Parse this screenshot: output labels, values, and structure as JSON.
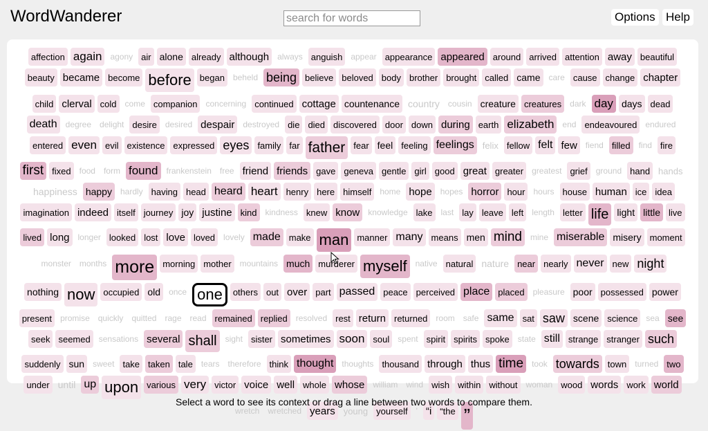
{
  "app": {
    "title": "WordWanderer"
  },
  "search": {
    "placeholder": "search for words",
    "value": ""
  },
  "nav": {
    "options_label": "Options",
    "help_label": "Help"
  },
  "status": {
    "text": "Select a word to see its context or drag a line between two words to compare them."
  },
  "selected_word": "one",
  "colors": {
    "page_bg": "#efefef",
    "panel_bg": "#ffffff",
    "faint_text": "#c9c9c9",
    "shade_1": "#f4e2ea",
    "shade_2": "#ecccda",
    "shade_3": "#e3b6ca",
    "shade_4": "#d99fb9"
  },
  "words": [
    {
      "t": "affection",
      "s": 13,
      "l": 1
    },
    {
      "t": "again",
      "s": 17,
      "l": 1
    },
    {
      "t": "agony",
      "s": 12,
      "l": 0
    },
    {
      "t": "air",
      "s": 13,
      "l": 1
    },
    {
      "t": "alone",
      "s": 14,
      "l": 1
    },
    {
      "t": "already",
      "s": 13,
      "l": 1
    },
    {
      "t": "although",
      "s": 15,
      "l": 1
    },
    {
      "t": "always",
      "s": 12,
      "l": 0
    },
    {
      "t": "anguish",
      "s": 13,
      "l": 1
    },
    {
      "t": "appear",
      "s": 12,
      "l": 0
    },
    {
      "t": "appearance",
      "s": 13,
      "l": 1
    },
    {
      "t": "appeared",
      "s": 15,
      "l": 3
    },
    {
      "t": "around",
      "s": 13,
      "l": 1
    },
    {
      "t": "arrived",
      "s": 13,
      "l": 1
    },
    {
      "t": "attention",
      "s": 13,
      "l": 1
    },
    {
      "t": "away",
      "s": 15,
      "l": 1
    },
    {
      "t": "beautiful",
      "s": 13,
      "l": 1
    },
    {
      "t": "beauty",
      "s": 13,
      "l": 1
    },
    {
      "t": "became",
      "s": 15,
      "l": 1
    },
    {
      "t": "become",
      "s": 13,
      "l": 1
    },
    {
      "t": "before",
      "s": 22,
      "l": 1
    },
    {
      "t": "began",
      "s": 13,
      "l": 1
    },
    {
      "t": "beheld",
      "s": 12,
      "l": 0
    },
    {
      "t": "being",
      "s": 18,
      "l": 3
    },
    {
      "t": "believe",
      "s": 13,
      "l": 1
    },
    {
      "t": "beloved",
      "s": 13,
      "l": 1
    },
    {
      "t": "body",
      "s": 13,
      "l": 1
    },
    {
      "t": "brother",
      "s": 13,
      "l": 1
    },
    {
      "t": "brought",
      "s": 13,
      "l": 1
    },
    {
      "t": "called",
      "s": 13,
      "l": 1
    },
    {
      "t": "came",
      "s": 14,
      "l": 1
    },
    {
      "t": "care",
      "s": 12,
      "l": 0
    },
    {
      "t": "cause",
      "s": 13,
      "l": 1
    },
    {
      "t": "change",
      "s": 13,
      "l": 1
    },
    {
      "t": "chapter",
      "s": 15,
      "l": 1
    },
    {
      "t": "child",
      "s": 13,
      "l": 1
    },
    {
      "t": "clerval",
      "s": 15,
      "l": 1
    },
    {
      "t": "cold",
      "s": 13,
      "l": 1
    },
    {
      "t": "come",
      "s": 12,
      "l": 0
    },
    {
      "t": "companion",
      "s": 13,
      "l": 1
    },
    {
      "t": "concerning",
      "s": 12,
      "l": 0
    },
    {
      "t": "continued",
      "s": 13,
      "l": 1
    },
    {
      "t": "cottage",
      "s": 15,
      "l": 1
    },
    {
      "t": "countenance",
      "s": 14,
      "l": 1
    },
    {
      "t": "country",
      "s": 14,
      "l": 0
    },
    {
      "t": "cousin",
      "s": 12,
      "l": 0
    },
    {
      "t": "creature",
      "s": 14,
      "l": 1
    },
    {
      "t": "creatures",
      "s": 13,
      "l": 2
    },
    {
      "t": "dark",
      "s": 12,
      "l": 0
    },
    {
      "t": "day",
      "s": 17,
      "l": 4
    },
    {
      "t": "days",
      "s": 14,
      "l": 1
    },
    {
      "t": "dead",
      "s": 13,
      "l": 1
    },
    {
      "t": "death",
      "s": 16,
      "l": 1
    },
    {
      "t": "degree",
      "s": 12,
      "l": 0
    },
    {
      "t": "delight",
      "s": 12,
      "l": 0
    },
    {
      "t": "desire",
      "s": 13,
      "l": 1
    },
    {
      "t": "desired",
      "s": 12,
      "l": 0
    },
    {
      "t": "despair",
      "s": 15,
      "l": 1
    },
    {
      "t": "destroyed",
      "s": 12,
      "l": 0
    },
    {
      "t": "die",
      "s": 13,
      "l": 1
    },
    {
      "t": "died",
      "s": 13,
      "l": 1
    },
    {
      "t": "discovered",
      "s": 13,
      "l": 1
    },
    {
      "t": "door",
      "s": 13,
      "l": 1
    },
    {
      "t": "down",
      "s": 13,
      "l": 1
    },
    {
      "t": "during",
      "s": 15,
      "l": 2
    },
    {
      "t": "earth",
      "s": 13,
      "l": 1
    },
    {
      "t": "elizabeth",
      "s": 17,
      "l": 2
    },
    {
      "t": "end",
      "s": 12,
      "l": 0
    },
    {
      "t": "endeavoured",
      "s": 13,
      "l": 1
    },
    {
      "t": "endured",
      "s": 12,
      "l": 0
    },
    {
      "t": "entered",
      "s": 13,
      "l": 1
    },
    {
      "t": "even",
      "s": 17,
      "l": 1
    },
    {
      "t": "evil",
      "s": 13,
      "l": 1
    },
    {
      "t": "existence",
      "s": 13,
      "l": 1
    },
    {
      "t": "expressed",
      "s": 13,
      "l": 1
    },
    {
      "t": "eyes",
      "s": 18,
      "l": 1
    },
    {
      "t": "family",
      "s": 13,
      "l": 1
    },
    {
      "t": "far",
      "s": 13,
      "l": 1
    },
    {
      "t": "father",
      "s": 21,
      "l": 2
    },
    {
      "t": "fear",
      "s": 13,
      "l": 1
    },
    {
      "t": "feel",
      "s": 14,
      "l": 1
    },
    {
      "t": "feeling",
      "s": 13,
      "l": 1
    },
    {
      "t": "feelings",
      "s": 16,
      "l": 2
    },
    {
      "t": "felix",
      "s": 13,
      "l": 0
    },
    {
      "t": "fellow",
      "s": 13,
      "l": 1
    },
    {
      "t": "felt",
      "s": 16,
      "l": 1
    },
    {
      "t": "few",
      "s": 15,
      "l": 1
    },
    {
      "t": "fiend",
      "s": 12,
      "l": 0
    },
    {
      "t": "filled",
      "s": 13,
      "l": 2
    },
    {
      "t": "find",
      "s": 12,
      "l": 0
    },
    {
      "t": "fire",
      "s": 13,
      "l": 1
    },
    {
      "t": "first",
      "s": 19,
      "l": 3
    },
    {
      "t": "fixed",
      "s": 13,
      "l": 1
    },
    {
      "t": "food",
      "s": 12,
      "l": 0
    },
    {
      "t": "form",
      "s": 12,
      "l": 0
    },
    {
      "t": "found",
      "s": 17,
      "l": 3
    },
    {
      "t": "frankenstein",
      "s": 12,
      "l": 0
    },
    {
      "t": "free",
      "s": 12,
      "l": 0
    },
    {
      "t": "friend",
      "s": 15,
      "l": 1
    },
    {
      "t": "friends",
      "s": 15,
      "l": 2
    },
    {
      "t": "gave",
      "s": 13,
      "l": 1
    },
    {
      "t": "geneva",
      "s": 13,
      "l": 1
    },
    {
      "t": "gentle",
      "s": 13,
      "l": 1
    },
    {
      "t": "girl",
      "s": 13,
      "l": 1
    },
    {
      "t": "good",
      "s": 13,
      "l": 1
    },
    {
      "t": "great",
      "s": 15,
      "l": 1
    },
    {
      "t": "greater",
      "s": 13,
      "l": 1
    },
    {
      "t": "greatest",
      "s": 12,
      "l": 0
    },
    {
      "t": "grief",
      "s": 13,
      "l": 1
    },
    {
      "t": "ground",
      "s": 12,
      "l": 0
    },
    {
      "t": "hand",
      "s": 13,
      "l": 1
    },
    {
      "t": "hands",
      "s": 13,
      "l": 0
    },
    {
      "t": "happiness",
      "s": 14,
      "l": 0
    },
    {
      "t": "happy",
      "s": 14,
      "l": 2
    },
    {
      "t": "hardly",
      "s": 12,
      "l": 0
    },
    {
      "t": "having",
      "s": 13,
      "l": 1
    },
    {
      "t": "head",
      "s": 13,
      "l": 1
    },
    {
      "t": "heard",
      "s": 16,
      "l": 2
    },
    {
      "t": "heart",
      "s": 17,
      "l": 1
    },
    {
      "t": "henry",
      "s": 13,
      "l": 1
    },
    {
      "t": "here",
      "s": 13,
      "l": 1
    },
    {
      "t": "himself",
      "s": 13,
      "l": 1
    },
    {
      "t": "home",
      "s": 12,
      "l": 0
    },
    {
      "t": "hope",
      "s": 15,
      "l": 1
    },
    {
      "t": "hopes",
      "s": 12,
      "l": 0
    },
    {
      "t": "horror",
      "s": 15,
      "l": 2
    },
    {
      "t": "hour",
      "s": 13,
      "l": 1
    },
    {
      "t": "hours",
      "s": 12,
      "l": 0
    },
    {
      "t": "house",
      "s": 13,
      "l": 1
    },
    {
      "t": "human",
      "s": 15,
      "l": 1
    },
    {
      "t": "ice",
      "s": 13,
      "l": 1
    },
    {
      "t": "idea",
      "s": 13,
      "l": 1
    },
    {
      "t": "imagination",
      "s": 13,
      "l": 1
    },
    {
      "t": "indeed",
      "s": 15,
      "l": 1
    },
    {
      "t": "itself",
      "s": 13,
      "l": 1
    },
    {
      "t": "journey",
      "s": 13,
      "l": 1
    },
    {
      "t": "joy",
      "s": 14,
      "l": 1
    },
    {
      "t": "justine",
      "s": 15,
      "l": 1
    },
    {
      "t": "kind",
      "s": 13,
      "l": 2
    },
    {
      "t": "kindness",
      "s": 12,
      "l": 0
    },
    {
      "t": "knew",
      "s": 13,
      "l": 1
    },
    {
      "t": "know",
      "s": 15,
      "l": 2
    },
    {
      "t": "knowledge",
      "s": 12,
      "l": 0
    },
    {
      "t": "lake",
      "s": 13,
      "l": 1
    },
    {
      "t": "last",
      "s": 12,
      "l": 0
    },
    {
      "t": "lay",
      "s": 13,
      "l": 1
    },
    {
      "t": "leave",
      "s": 13,
      "l": 1
    },
    {
      "t": "left",
      "s": 13,
      "l": 1
    },
    {
      "t": "length",
      "s": 12,
      "l": 0
    },
    {
      "t": "letter",
      "s": 13,
      "l": 1
    },
    {
      "t": "life",
      "s": 20,
      "l": 3
    },
    {
      "t": "light",
      "s": 14,
      "l": 1
    },
    {
      "t": "little",
      "s": 14,
      "l": 3
    },
    {
      "t": "live",
      "s": 13,
      "l": 1
    },
    {
      "t": "lived",
      "s": 13,
      "l": 2
    },
    {
      "t": "long",
      "s": 15,
      "l": 1
    },
    {
      "t": "longer",
      "s": 12,
      "l": 0
    },
    {
      "t": "looked",
      "s": 13,
      "l": 1
    },
    {
      "t": "lost",
      "s": 13,
      "l": 1
    },
    {
      "t": "love",
      "s": 15,
      "l": 1
    },
    {
      "t": "loved",
      "s": 13,
      "l": 1
    },
    {
      "t": "lovely",
      "s": 12,
      "l": 0
    },
    {
      "t": "made",
      "s": 16,
      "l": 2
    },
    {
      "t": "make",
      "s": 13,
      "l": 1
    },
    {
      "t": "man",
      "s": 22,
      "l": 4
    },
    {
      "t": "manner",
      "s": 13,
      "l": 1
    },
    {
      "t": "many",
      "s": 16,
      "l": 1
    },
    {
      "t": "means",
      "s": 13,
      "l": 1
    },
    {
      "t": "men",
      "s": 14,
      "l": 1
    },
    {
      "t": "mind",
      "s": 19,
      "l": 2
    },
    {
      "t": "mine",
      "s": 12,
      "l": 0
    },
    {
      "t": "miserable",
      "s": 16,
      "l": 2
    },
    {
      "t": "misery",
      "s": 14,
      "l": 1
    },
    {
      "t": "moment",
      "s": 13,
      "l": 1
    },
    {
      "t": "monster",
      "s": 12,
      "l": 0
    },
    {
      "t": "months",
      "s": 12,
      "l": 0
    },
    {
      "t": "more",
      "s": 25,
      "l": 3
    },
    {
      "t": "morning",
      "s": 13,
      "l": 1
    },
    {
      "t": "mother",
      "s": 13,
      "l": 1
    },
    {
      "t": "mountains",
      "s": 12,
      "l": 0
    },
    {
      "t": "much",
      "s": 14,
      "l": 3
    },
    {
      "t": "murderer",
      "s": 13,
      "l": 1
    },
    {
      "t": "myself",
      "s": 22,
      "l": 3
    },
    {
      "t": "native",
      "s": 12,
      "l": 0
    },
    {
      "t": "natural",
      "s": 13,
      "l": 1
    },
    {
      "t": "nature",
      "s": 14,
      "l": 0
    },
    {
      "t": "near",
      "s": 13,
      "l": 2
    },
    {
      "t": "nearly",
      "s": 13,
      "l": 1
    },
    {
      "t": "never",
      "s": 16,
      "l": 1
    },
    {
      "t": "new",
      "s": 13,
      "l": 1
    },
    {
      "t": "night",
      "s": 18,
      "l": 1
    },
    {
      "t": "nothing",
      "s": 14,
      "l": 1
    },
    {
      "t": "now",
      "s": 22,
      "l": 1
    },
    {
      "t": "occupied",
      "s": 13,
      "l": 1
    },
    {
      "t": "old",
      "s": 14,
      "l": 1
    },
    {
      "t": "once",
      "s": 12,
      "l": 0
    },
    {
      "t": "one",
      "s": 22,
      "l": 1
    },
    {
      "t": "others",
      "s": 13,
      "l": 1
    },
    {
      "t": "out",
      "s": 13,
      "l": 1
    },
    {
      "t": "over",
      "s": 15,
      "l": 1
    },
    {
      "t": "part",
      "s": 13,
      "l": 1
    },
    {
      "t": "passed",
      "s": 16,
      "l": 1
    },
    {
      "t": "peace",
      "s": 13,
      "l": 1
    },
    {
      "t": "perceived",
      "s": 13,
      "l": 1
    },
    {
      "t": "place",
      "s": 16,
      "l": 3
    },
    {
      "t": "placed",
      "s": 13,
      "l": 2
    },
    {
      "t": "pleasure",
      "s": 12,
      "l": 0
    },
    {
      "t": "poor",
      "s": 14,
      "l": 1
    },
    {
      "t": "possessed",
      "s": 13,
      "l": 1
    },
    {
      "t": "power",
      "s": 14,
      "l": 1
    },
    {
      "t": "present",
      "s": 13,
      "l": 1
    },
    {
      "t": "promise",
      "s": 12,
      "l": 0
    },
    {
      "t": "quickly",
      "s": 12,
      "l": 0
    },
    {
      "t": "quitted",
      "s": 12,
      "l": 0
    },
    {
      "t": "rage",
      "s": 12,
      "l": 0
    },
    {
      "t": "read",
      "s": 12,
      "l": 0
    },
    {
      "t": "remained",
      "s": 13,
      "l": 2
    },
    {
      "t": "replied",
      "s": 13,
      "l": 2
    },
    {
      "t": "resolved",
      "s": 12,
      "l": 0
    },
    {
      "t": "rest",
      "s": 13,
      "l": 1
    },
    {
      "t": "return",
      "s": 15,
      "l": 1
    },
    {
      "t": "returned",
      "s": 13,
      "l": 1
    },
    {
      "t": "room",
      "s": 12,
      "l": 0
    },
    {
      "t": "safe",
      "s": 12,
      "l": 0
    },
    {
      "t": "same",
      "s": 16,
      "l": 1
    },
    {
      "t": "sat",
      "s": 13,
      "l": 1
    },
    {
      "t": "saw",
      "s": 18,
      "l": 1
    },
    {
      "t": "scene",
      "s": 14,
      "l": 1
    },
    {
      "t": "science",
      "s": 13,
      "l": 1
    },
    {
      "t": "sea",
      "s": 12,
      "l": 0
    },
    {
      "t": "see",
      "s": 14,
      "l": 3
    },
    {
      "t": "seek",
      "s": 13,
      "l": 1
    },
    {
      "t": "seemed",
      "s": 13,
      "l": 1
    },
    {
      "t": "sensations",
      "s": 12,
      "l": 0
    },
    {
      "t": "several",
      "s": 15,
      "l": 2
    },
    {
      "t": "shall",
      "s": 20,
      "l": 2
    },
    {
      "t": "sight",
      "s": 12,
      "l": 0
    },
    {
      "t": "sister",
      "s": 13,
      "l": 1
    },
    {
      "t": "sometimes",
      "s": 15,
      "l": 1
    },
    {
      "t": "soon",
      "s": 17,
      "l": 1
    },
    {
      "t": "soul",
      "s": 13,
      "l": 1
    },
    {
      "t": "spent",
      "s": 12,
      "l": 0
    },
    {
      "t": "spirit",
      "s": 13,
      "l": 1
    },
    {
      "t": "spirits",
      "s": 13,
      "l": 1
    },
    {
      "t": "spoke",
      "s": 13,
      "l": 1
    },
    {
      "t": "state",
      "s": 12,
      "l": 0
    },
    {
      "t": "still",
      "s": 16,
      "l": 1
    },
    {
      "t": "strange",
      "s": 13,
      "l": 1
    },
    {
      "t": "stranger",
      "s": 13,
      "l": 1
    },
    {
      "t": "such",
      "s": 18,
      "l": 2
    },
    {
      "t": "suddenly",
      "s": 13,
      "l": 1
    },
    {
      "t": "sun",
      "s": 14,
      "l": 1
    },
    {
      "t": "sweet",
      "s": 12,
      "l": 0
    },
    {
      "t": "take",
      "s": 13,
      "l": 1
    },
    {
      "t": "taken",
      "s": 13,
      "l": 2
    },
    {
      "t": "tale",
      "s": 13,
      "l": 1
    },
    {
      "t": "tears",
      "s": 12,
      "l": 0
    },
    {
      "t": "therefore",
      "s": 12,
      "l": 0
    },
    {
      "t": "think",
      "s": 13,
      "l": 1
    },
    {
      "t": "thought",
      "s": 16,
      "l": 4
    },
    {
      "t": "thoughts",
      "s": 12,
      "l": 0
    },
    {
      "t": "thousand",
      "s": 13,
      "l": 1
    },
    {
      "t": "through",
      "s": 15,
      "l": 1
    },
    {
      "t": "thus",
      "s": 15,
      "l": 1
    },
    {
      "t": "time",
      "s": 19,
      "l": 4
    },
    {
      "t": "took",
      "s": 12,
      "l": 0
    },
    {
      "t": "towards",
      "s": 18,
      "l": 2
    },
    {
      "t": "town",
      "s": 13,
      "l": 1
    },
    {
      "t": "turned",
      "s": 12,
      "l": 0
    },
    {
      "t": "two",
      "s": 13,
      "l": 3
    },
    {
      "t": "under",
      "s": 13,
      "l": 1
    },
    {
      "t": "until",
      "s": 14,
      "l": 0
    },
    {
      "t": "up",
      "s": 16,
      "l": 2
    },
    {
      "t": "upon",
      "s": 22,
      "l": 1
    },
    {
      "t": "various",
      "s": 13,
      "l": 2
    },
    {
      "t": "very",
      "s": 17,
      "l": 1
    },
    {
      "t": "victor",
      "s": 13,
      "l": 1
    },
    {
      "t": "voice",
      "s": 15,
      "l": 1
    },
    {
      "t": "well",
      "s": 15,
      "l": 1
    },
    {
      "t": "whole",
      "s": 13,
      "l": 1
    },
    {
      "t": "whose",
      "s": 15,
      "l": 2
    },
    {
      "t": "william",
      "s": 12,
      "l": 0
    },
    {
      "t": "wind",
      "s": 12,
      "l": 0
    },
    {
      "t": "wish",
      "s": 13,
      "l": 1
    },
    {
      "t": "within",
      "s": 13,
      "l": 1
    },
    {
      "t": "without",
      "s": 13,
      "l": 1
    },
    {
      "t": "woman",
      "s": 12,
      "l": 0
    },
    {
      "t": "wood",
      "s": 13,
      "l": 1
    },
    {
      "t": "words",
      "s": 15,
      "l": 1
    },
    {
      "t": "work",
      "s": 13,
      "l": 1
    },
    {
      "t": "world",
      "s": 15,
      "l": 2
    },
    {
      "t": "wretch",
      "s": 12,
      "l": 0
    },
    {
      "t": "wretched",
      "s": 12,
      "l": 0
    },
    {
      "t": "years",
      "s": 15,
      "l": 1
    },
    {
      "t": "young",
      "s": 13,
      "l": 0
    },
    {
      "t": "yourself",
      "s": 13,
      "l": 1
    },
    {
      "t": "'",
      "s": 12,
      "l": 0
    },
    {
      "t": "“i",
      "s": 15,
      "l": 1
    },
    {
      "t": "“the",
      "s": 13,
      "l": 1
    },
    {
      "t": "”",
      "s": 28,
      "l": 3
    }
  ]
}
